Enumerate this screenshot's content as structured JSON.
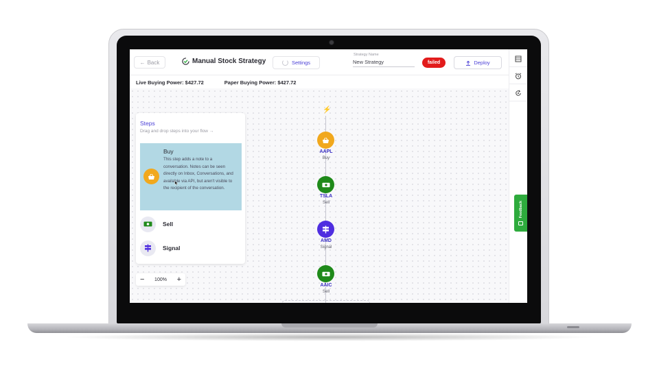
{
  "header": {
    "back_label": "Back",
    "title": "Manual Stock Strategy",
    "settings_label": "Settings",
    "strategy_name_label": "Strategy Name",
    "strategy_name_value": "New Strategy",
    "status_badge": "failed",
    "deploy_label": "Deploy"
  },
  "buying_power": {
    "live": "Live Buying Power: $427.72",
    "paper": "Paper Buying Power: $427.72"
  },
  "steps_panel": {
    "title": "Steps",
    "subtitle": "Drag and drop steps into your flow →",
    "items": [
      {
        "label": "Buy",
        "description": "This step adds a note to a conversation. Notes can be seen directly on Inbox, Conversations, and available via API, but aren't visible to the recipient of the conversation.",
        "icon": "basket-icon",
        "highlighted": true
      },
      {
        "label": "Sell",
        "icon": "cash-icon"
      },
      {
        "label": "Signal",
        "icon": "signpost-icon"
      }
    ]
  },
  "zoom": {
    "minus": "−",
    "level": "100%",
    "plus": "+"
  },
  "flow": {
    "trigger_icon": "lightning-icon",
    "nodes": [
      {
        "ticker": "AAPL",
        "action": "Buy",
        "color": "#f1a81d",
        "icon": "basket-icon"
      },
      {
        "ticker": "TSLA",
        "action": "Sell",
        "color": "#1f8a1a",
        "icon": "cash-icon"
      },
      {
        "ticker": "AMD",
        "action": "Signal",
        "color": "#4f2ee0",
        "icon": "signpost-icon"
      },
      {
        "ticker": "AAIC",
        "action": "Sell",
        "color": "#1f8a1a",
        "icon": "cash-icon"
      }
    ]
  },
  "right_rail": {
    "icons": [
      "panel-icon",
      "alarm-icon",
      "refresh-icon"
    ],
    "feedback_label": "Feedback"
  },
  "colors": {
    "accent": "#4a3fd6",
    "failed": "#e21b1b",
    "buy": "#f1a81d",
    "sell": "#1f8a1a",
    "signal": "#4f2ee0",
    "feedback": "#2eab3d"
  }
}
